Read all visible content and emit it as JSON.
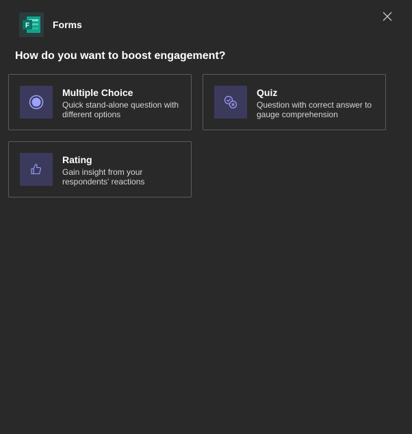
{
  "app": {
    "name": "Forms",
    "logo_letter": "F"
  },
  "prompt": "How do you want to boost engagement?",
  "options": [
    {
      "title": "Multiple Choice",
      "description": "Quick stand-alone question with different options",
      "icon": "radio-button-icon"
    },
    {
      "title": "Quiz",
      "description": "Question with correct answer to gauge comprehension",
      "icon": "quiz-check-icon"
    },
    {
      "title": "Rating",
      "description": "Gain insight from your respondents' reactions",
      "icon": "thumbs-up-icon"
    }
  ],
  "colors": {
    "background": "#292929",
    "card_border": "#5c5c5c",
    "icon_tile": "#3b3a5c",
    "accent": "#8b8cc7",
    "brand": "#038387"
  }
}
